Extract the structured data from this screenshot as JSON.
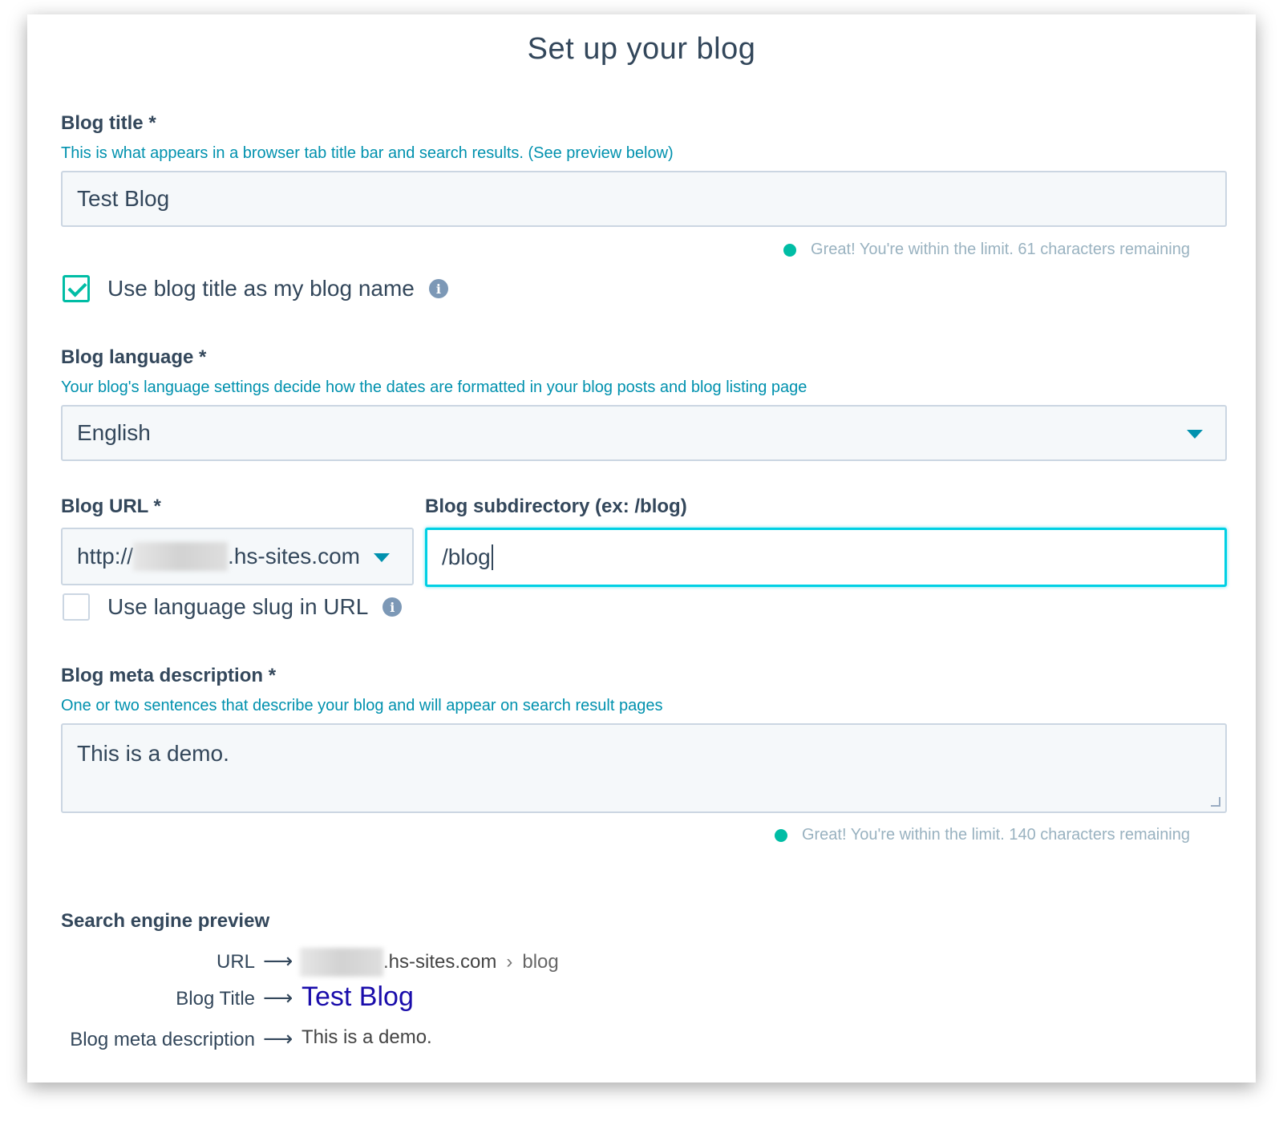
{
  "page_title": "Set up your blog",
  "blog_title": {
    "label": "Blog title *",
    "help": "This is what appears in a browser tab title bar and search results. (See preview below)",
    "value": "Test Blog",
    "status": "Great! You're within the limit. 61 characters remaining"
  },
  "use_title_as_name": {
    "label": "Use blog title as my blog name",
    "checked": true
  },
  "blog_language": {
    "label": "Blog language *",
    "help": "Your blog's language settings decide how the dates are formatted in your blog posts and blog listing page",
    "value": "English"
  },
  "blog_url": {
    "label": "Blog URL *",
    "prefix": "http://",
    "domain_suffix": ".hs-sites.com"
  },
  "blog_subdirectory": {
    "label": "Blog subdirectory (ex: /blog)",
    "value": "/blog"
  },
  "use_language_slug": {
    "label": "Use language slug in URL",
    "checked": false
  },
  "blog_meta_description": {
    "label": "Blog meta description *",
    "help": "One or two sentences that describe your blog and will appear on search result pages",
    "value": "This is a demo.",
    "status": "Great! You're within the limit. 140 characters remaining"
  },
  "search_preview": {
    "heading": "Search engine preview",
    "url_label": "URL",
    "url_domain": ".hs-sites.com",
    "url_separator": "›",
    "url_path": "blog",
    "title_label": "Blog Title",
    "title_value": "Test Blog",
    "description_label": "Blog meta description",
    "description_value": "This is a demo.",
    "arrow": "⟶"
  },
  "colors": {
    "accent": "#00bda5",
    "link_help": "#0091ae",
    "text": "#33475b",
    "preview_title": "#1a0dab"
  }
}
